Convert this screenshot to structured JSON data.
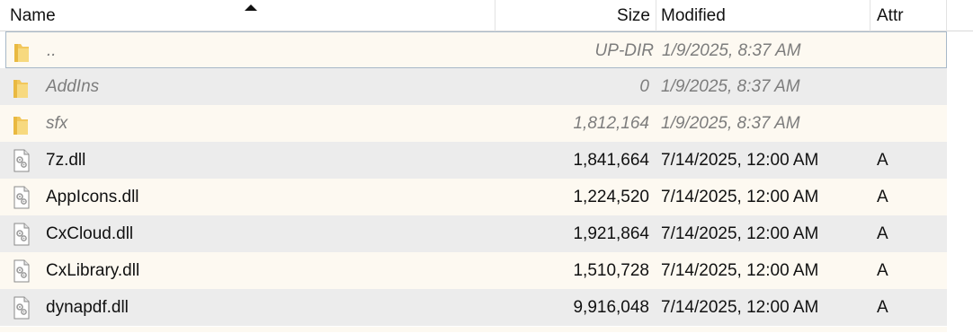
{
  "header": {
    "name_label": "Name",
    "size_label": "Size",
    "modified_label": "Modified",
    "attr_label": "Attr",
    "sort_column": "Name",
    "sort_direction": "ascending"
  },
  "rows": [
    {
      "icon": "folder-icon",
      "name": "..",
      "size": "UP-DIR",
      "modified": "1/9/2025, 8:37 AM",
      "attr": "",
      "kind": "dir",
      "selected": true
    },
    {
      "icon": "folder-icon",
      "name": "AddIns",
      "size": "0",
      "modified": "1/9/2025, 8:37 AM",
      "attr": "",
      "kind": "dir"
    },
    {
      "icon": "folder-icon",
      "name": "sfx",
      "size": "1,812,164",
      "modified": "1/9/2025, 8:37 AM",
      "attr": "",
      "kind": "dir"
    },
    {
      "icon": "dll-file-icon",
      "name": "7z.dll",
      "size": "1,841,664",
      "modified": "7/14/2025, 12:00 AM",
      "attr": "A",
      "kind": "file"
    },
    {
      "icon": "dll-file-icon",
      "name": "AppIcons.dll",
      "size": "1,224,520",
      "modified": "7/14/2025, 12:00 AM",
      "attr": "A",
      "kind": "file"
    },
    {
      "icon": "dll-file-icon",
      "name": "CxCloud.dll",
      "size": "1,921,864",
      "modified": "7/14/2025, 12:00 AM",
      "attr": "A",
      "kind": "file"
    },
    {
      "icon": "dll-file-icon",
      "name": "CxLibrary.dll",
      "size": "1,510,728",
      "modified": "7/14/2025, 12:00 AM",
      "attr": "A",
      "kind": "file"
    },
    {
      "icon": "dll-file-icon",
      "name": "dynapdf.dll",
      "size": "9,916,048",
      "modified": "7/14/2025, 12:00 AM",
      "attr": "A",
      "kind": "file"
    }
  ],
  "colors": {
    "row_alt": "#ececec",
    "row_normal": "#fdf9f1",
    "dir_text": "#7d7d7d",
    "folder_yellow": "#f5cf6a"
  }
}
